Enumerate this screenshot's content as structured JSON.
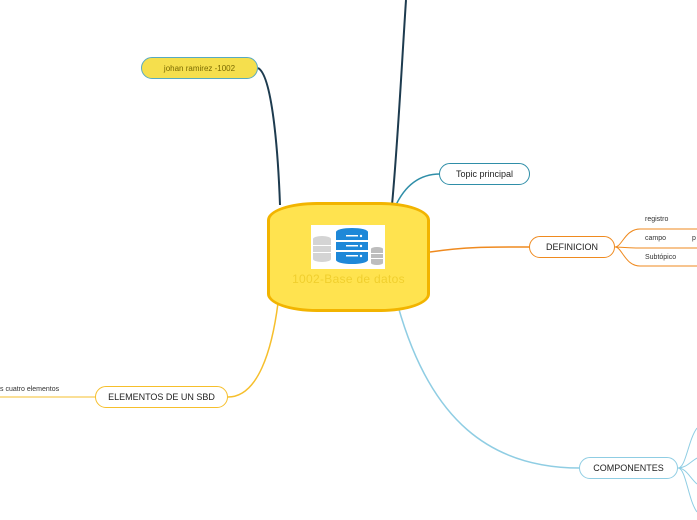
{
  "map": {
    "central_title": "1002-Base de datos",
    "branches": {
      "author": "johan ramirez -1002",
      "topic": "Topic principal",
      "definicion": "DEFINICION",
      "elementos": "ELEMENTOS DE UN SBD",
      "componentes": "COMPONENTES"
    },
    "definicion_children": {
      "registro": "registro",
      "campo": "campo",
      "subtopico": "Subtópico",
      "partial": "p"
    },
    "elementos_children": {
      "cuatro": "s cuatro elementos"
    }
  },
  "colors": {
    "central_fill": "#ffe34f",
    "central_border": "#f2b400",
    "author_fill": "#f5df4d",
    "author_border": "#58aac0",
    "dark_line": "#1d3b4f",
    "topic_line": "#2f8ea8",
    "definicion_line": "#ef8a1f",
    "elementos_line": "#f6bf2c",
    "componentes_line": "#8fcde3"
  }
}
